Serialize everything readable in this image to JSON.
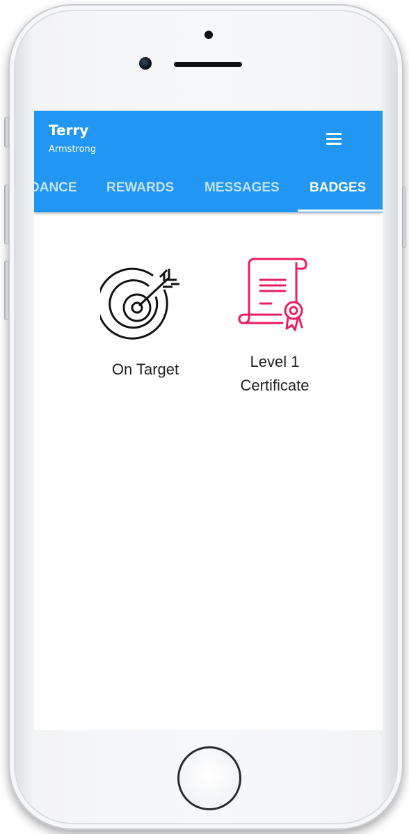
{
  "user": {
    "first_name": "Terry",
    "last_name": "Armstrong"
  },
  "header": {
    "menu_icon": "hamburger-menu-icon"
  },
  "tabs": [
    {
      "label": "DANCE",
      "active": false
    },
    {
      "label": "REWARDS",
      "active": false
    },
    {
      "label": "MESSAGES",
      "active": false
    },
    {
      "label": "BADGES",
      "active": true
    }
  ],
  "badges": [
    {
      "label": "On Target",
      "icon": "target-icon",
      "color": "#111111"
    },
    {
      "label": "Level 1\nCertificate",
      "icon": "certificate-icon",
      "color": "#e91e63"
    }
  ],
  "colors": {
    "primary": "#2196f3",
    "accent": "#e91e63"
  }
}
